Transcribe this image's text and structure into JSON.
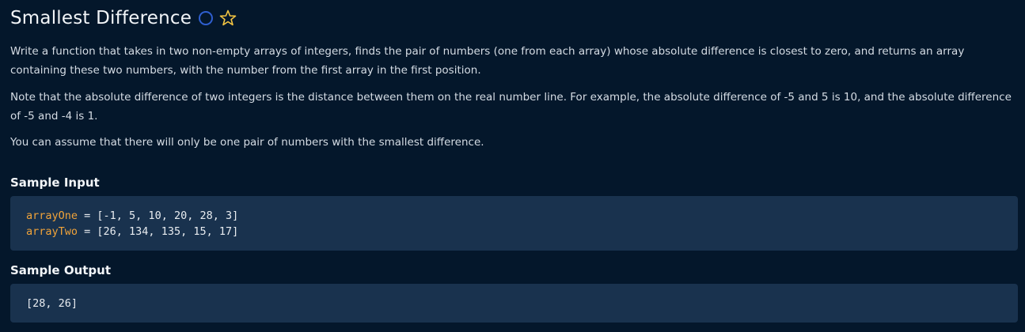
{
  "problem": {
    "title": "Smallest Difference",
    "paragraphs": [
      "Write a function that takes in two non-empty arrays of integers, finds the pair of numbers (one from each array) whose absolute difference is closest to zero, and returns an array containing these two numbers, with the number from the first array in the first position.",
      "Note that the absolute difference of two integers is the distance between them on the real number line. For example, the absolute difference of -5 and 5 is 10, and the absolute difference of -5 and -4 is 1.",
      "You can assume that there will only be one pair of numbers with the smallest difference."
    ]
  },
  "icons": {
    "status": "circle-outline-icon",
    "favorite": "star-outline-icon",
    "status_color": "#2f5fd0",
    "favorite_color": "#f4c542"
  },
  "sample_input": {
    "label": "Sample Input",
    "lines": [
      {
        "name": "arrayOne",
        "value": " = [-1, 5, 10, 20, 28, 3]"
      },
      {
        "name": "arrayTwo",
        "value": " = [26, 134, 135, 15, 17]"
      }
    ]
  },
  "sample_output": {
    "label": "Sample Output",
    "value": "[28, 26]"
  }
}
